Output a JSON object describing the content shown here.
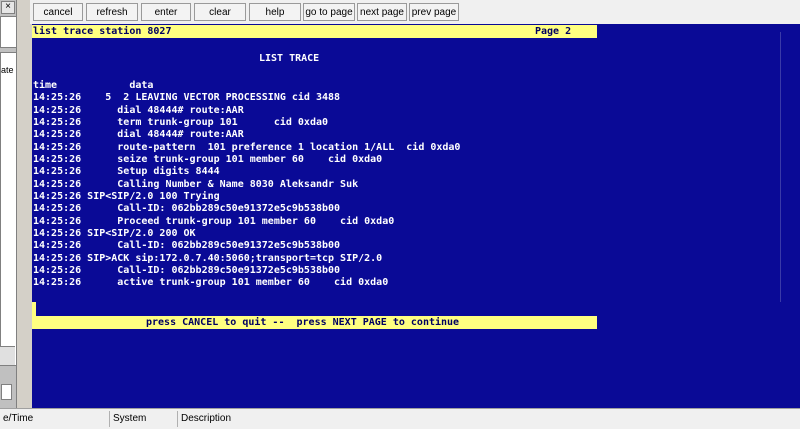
{
  "toolbar": {
    "cancel": "cancel",
    "refresh": "refresh",
    "enter": "enter",
    "clear": "clear",
    "help": "help",
    "goto_page": "go to page",
    "next_page": "next page",
    "prev_page": "prev page"
  },
  "left_pane": {
    "close_glyph": "×",
    "label_fragment": "ate"
  },
  "terminal": {
    "command": "list trace station 8027",
    "page_label": "Page   2",
    "title": "LIST TRACE",
    "column_header": "time            data",
    "lines": [
      "14:25:26    5  2 LEAVING VECTOR PROCESSING cid 3488",
      "14:25:26      dial 48444# route:AAR",
      "14:25:26      term trunk-group 101      cid 0xda0",
      "14:25:26      dial 48444# route:AAR",
      "14:25:26      route-pattern  101 preference 1 location 1/ALL  cid 0xda0",
      "14:25:26      seize trunk-group 101 member 60    cid 0xda0",
      "14:25:26      Setup digits 8444",
      "14:25:26      Calling Number & Name 8030 Aleksandr Suk",
      "14:25:26 SIP<SIP/2.0 100 Trying",
      "14:25:26      Call-ID: 062bb289c50e91372e5c9b538b00",
      "14:25:26      Proceed trunk-group 101 member 60    cid 0xda0",
      "14:25:26 SIP<SIP/2.0 200 OK",
      "14:25:26      Call-ID: 062bb289c50e91372e5c9b538b00",
      "14:25:26 SIP>ACK sip:172.0.7.40:5060;transport=tcp SIP/2.0",
      "14:25:26      Call-ID: 062bb289c50e91372e5c9b538b00",
      "14:25:26      active trunk-group 101 member 60    cid 0xda0"
    ],
    "footer": "press CANCEL to quit --  press NEXT PAGE to continue"
  },
  "status_header": {
    "columns": [
      "e/Time",
      "System",
      "Description"
    ]
  },
  "colors": {
    "terminal_bg": "#0a0a96",
    "highlight_bar": "#ffff80",
    "terminal_text": "#ffffff"
  }
}
